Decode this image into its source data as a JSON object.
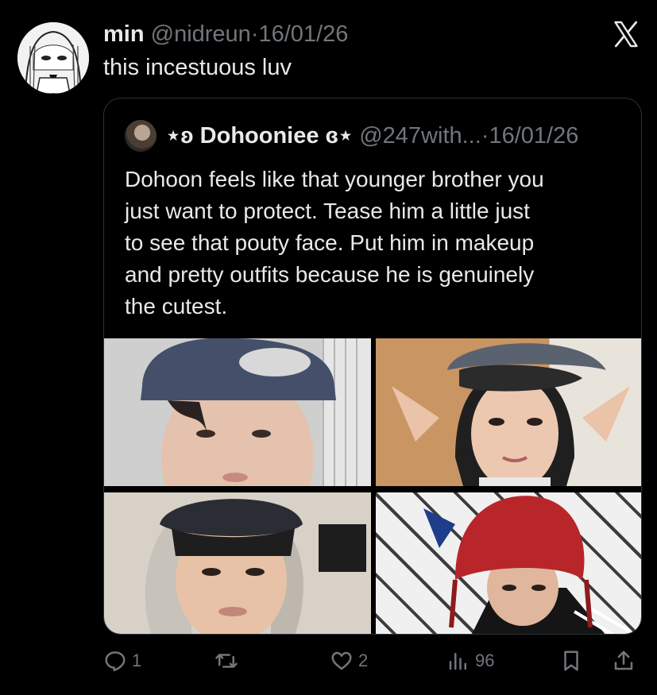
{
  "post": {
    "display_name": "min",
    "handle": "@nidreun",
    "separator": "·",
    "date": "16/01/26",
    "text": "this incestuous luv"
  },
  "quoted": {
    "display_name": "⋆ʚ Dohooniee ɞ⋆",
    "handle": "@247with...",
    "separator": "·",
    "date": "16/01/26",
    "text_lines": [
      "Dohoon feels like that younger brother you",
      "just want to protect. Tease him a little just",
      "to see that pouty face. Put him in makeup",
      "and pretty outfits because he is genuinely",
      "the cutest."
    ]
  },
  "actions": {
    "replies": "1",
    "reposts": "",
    "likes": "2",
    "views": "96"
  },
  "icons": {
    "logo": "x-logo-icon",
    "reply": "reply-icon",
    "repost": "repost-icon",
    "like": "heart-icon",
    "views": "views-icon",
    "bookmark": "bookmark-icon",
    "share": "share-icon"
  },
  "colors": {
    "background": "#000000",
    "text": "#e7e9ea",
    "muted": "#71767b",
    "border": "#2f3336"
  }
}
